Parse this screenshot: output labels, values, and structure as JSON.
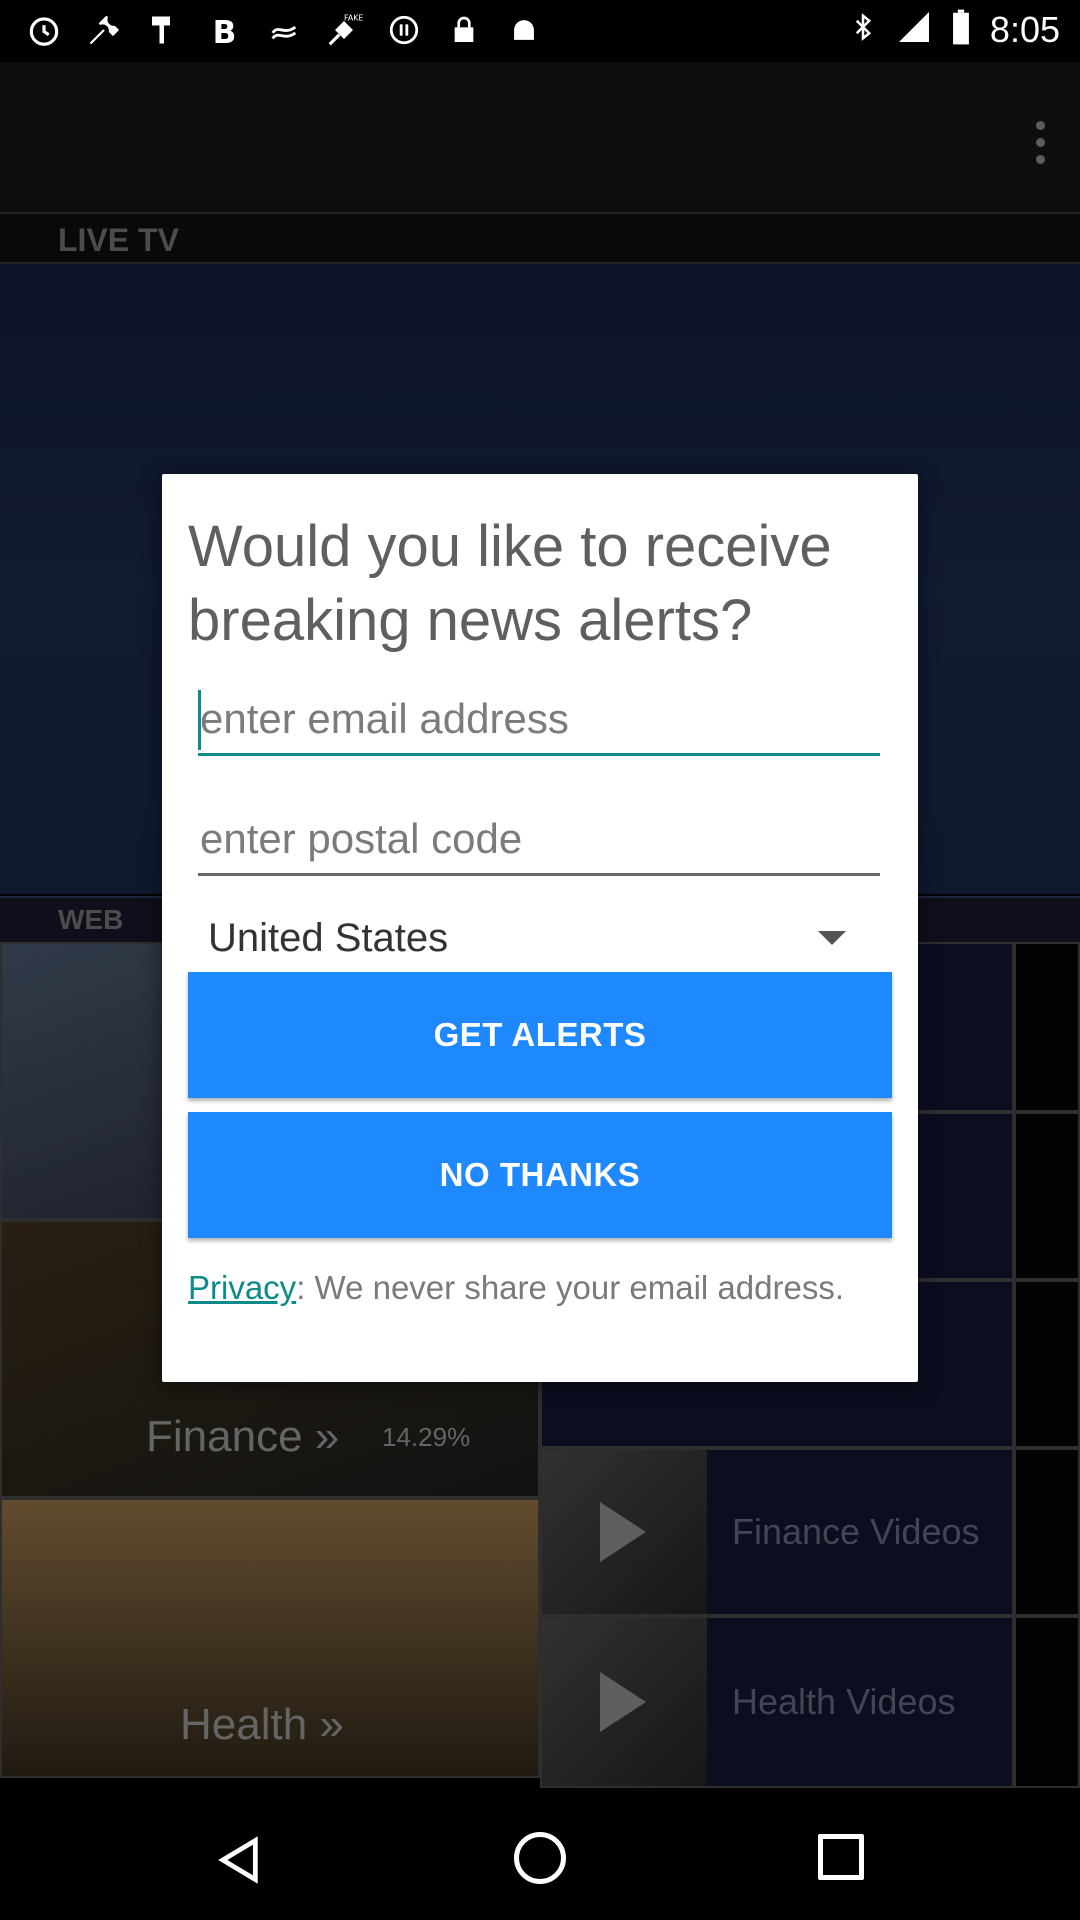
{
  "status_bar": {
    "time": "8:05",
    "left_icons": [
      "alarm-icon",
      "wrench-icon",
      "hammer-icon",
      "bold-icon",
      "fan-icon",
      "satellite-fake-icon",
      "pause-icon",
      "lock-icon",
      "android-icon"
    ],
    "right_icons": [
      "bluetooth-icon",
      "signal-icon",
      "battery-icon"
    ]
  },
  "background": {
    "section_live_tv": "LIVE TV",
    "section_web": "WEB",
    "tiles": {
      "finance": "Finance »",
      "health": "Health »",
      "finance_percent": "14.29%",
      "finance_videos": "Finance Videos",
      "health_videos": "Health Videos"
    }
  },
  "dialog": {
    "title": "Would you like to receive breaking news alerts?",
    "email_placeholder": "enter email address",
    "postal_placeholder": "enter postal code",
    "country": "United States",
    "get_alerts": "GET ALERTS",
    "no_thanks": "NO THANKS",
    "privacy_link": "Privacy",
    "privacy_text": ": We never share your email address."
  },
  "colors": {
    "button_blue": "#1e88ff",
    "accent_teal": "#0d8b8b"
  }
}
